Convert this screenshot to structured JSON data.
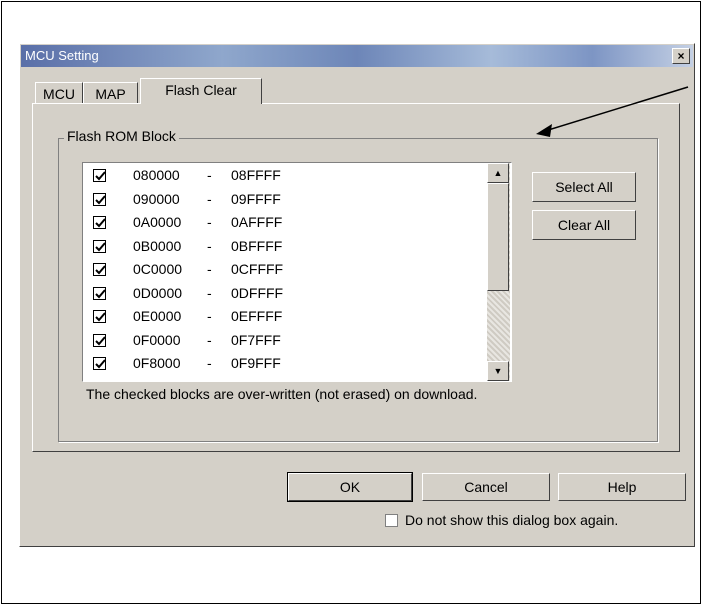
{
  "window": {
    "title": "MCU Setting",
    "close_glyph": "×"
  },
  "tabs": [
    {
      "label": "MCU",
      "active": false
    },
    {
      "label": "MAP",
      "active": false
    },
    {
      "label": "Flash Clear",
      "active": true
    }
  ],
  "group": {
    "label": "Flash ROM Block"
  },
  "blocks": [
    {
      "start": "080000",
      "end": "08FFFF",
      "checked": true
    },
    {
      "start": "090000",
      "end": "09FFFF",
      "checked": true
    },
    {
      "start": "0A0000",
      "end": "0AFFFF",
      "checked": true
    },
    {
      "start": "0B0000",
      "end": "0BFFFF",
      "checked": true
    },
    {
      "start": "0C0000",
      "end": "0CFFFF",
      "checked": true
    },
    {
      "start": "0D0000",
      "end": "0DFFFF",
      "checked": true
    },
    {
      "start": "0E0000",
      "end": "0EFFFF",
      "checked": true
    },
    {
      "start": "0F0000",
      "end": "0F7FFF",
      "checked": true
    },
    {
      "start": "0F8000",
      "end": "0F9FFF",
      "checked": true
    }
  ],
  "range_separator": "-",
  "buttons": {
    "select_all": "Select All",
    "clear_all": "Clear All",
    "ok": "OK",
    "cancel": "Cancel",
    "help": "Help"
  },
  "note": "The checked blocks are over-written (not erased) on download.",
  "dont_show": {
    "label": "Do not show this dialog box again.",
    "checked": false
  },
  "scroll_glyphs": {
    "up": "▲",
    "down": "▼"
  },
  "colors": {
    "dialog_bg": "#d4d0c8",
    "title_start": "#5a6fa8",
    "title_end": "#c4d0e4"
  }
}
